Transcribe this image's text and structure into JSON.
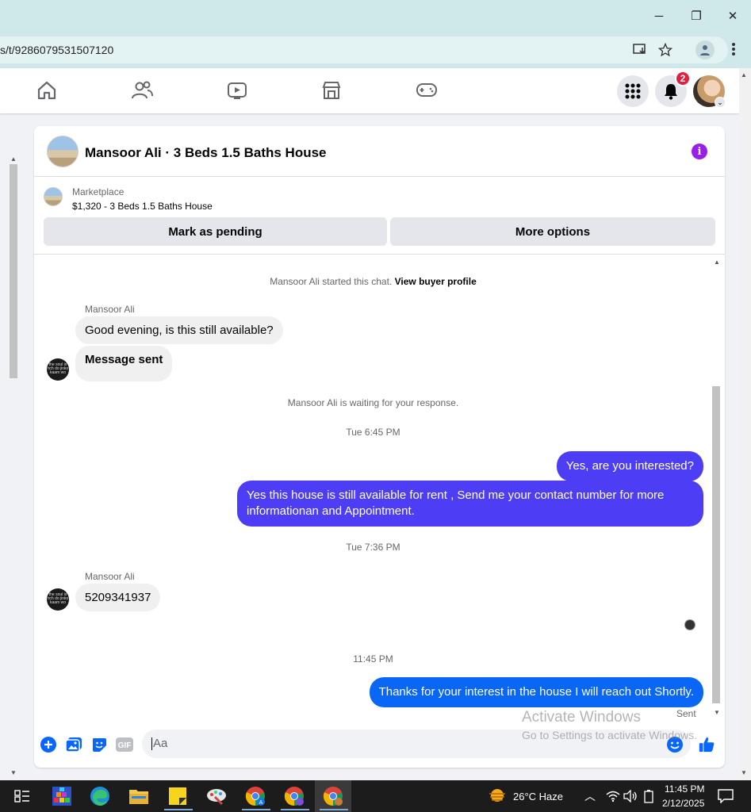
{
  "browser": {
    "url": "s/t/9286079531507120",
    "window_controls": {
      "minimize": "─",
      "restore": "❐",
      "close": "✕"
    }
  },
  "nav": {
    "icons": [
      "home-icon",
      "friends-icon",
      "video-icon",
      "marketplace-icon",
      "gaming-icon"
    ],
    "notifications_count": "2"
  },
  "chat": {
    "title": "Mansoor Ali · 3 Beds 1.5 Baths House",
    "info_glyph": "i",
    "marketplace": {
      "label": "Marketplace",
      "listing": "$1,320 - 3 Beds 1.5 Baths House"
    },
    "actions": {
      "mark_pending": "Mark as pending",
      "more_options": "More options"
    },
    "started_text": "Mansoor Ali started this chat.",
    "view_profile": "View buyer profile",
    "sender_name": "Mansoor Ali",
    "msg_in_1": "Good evening, is this still available?",
    "msg_in_2": "Message sent",
    "waiting_text": "Mansoor Ali is waiting for your response.",
    "time_1": "Tue 6:45 PM",
    "msg_out_1": "Yes, are you interested?",
    "msg_out_2": "Yes this house is still available for rent , Send me your contact number for more informationan and Appointment.",
    "time_2": "Tue 7:36 PM",
    "msg_in_3": "5209341937",
    "time_3": "11:45 PM",
    "msg_out_3": "Thanks for your interest in the house I will reach out Shortly.",
    "status": "Sent",
    "composer_placeholder": "Aa",
    "avatar_caption": "the soul is rich do jinko kaam wo"
  },
  "watermark": {
    "line1": "Activate Windows",
    "line2": "Go to Settings to activate Windows."
  },
  "taskbar": {
    "weather": "26°C  Haze",
    "time": "11:45 PM",
    "date": "2/12/2025"
  },
  "colors": {
    "outgoing": "#4d3ef5",
    "outgoing_latest": "#0a66f5",
    "accent": "#0866ff",
    "badge": "#e41e3f"
  }
}
